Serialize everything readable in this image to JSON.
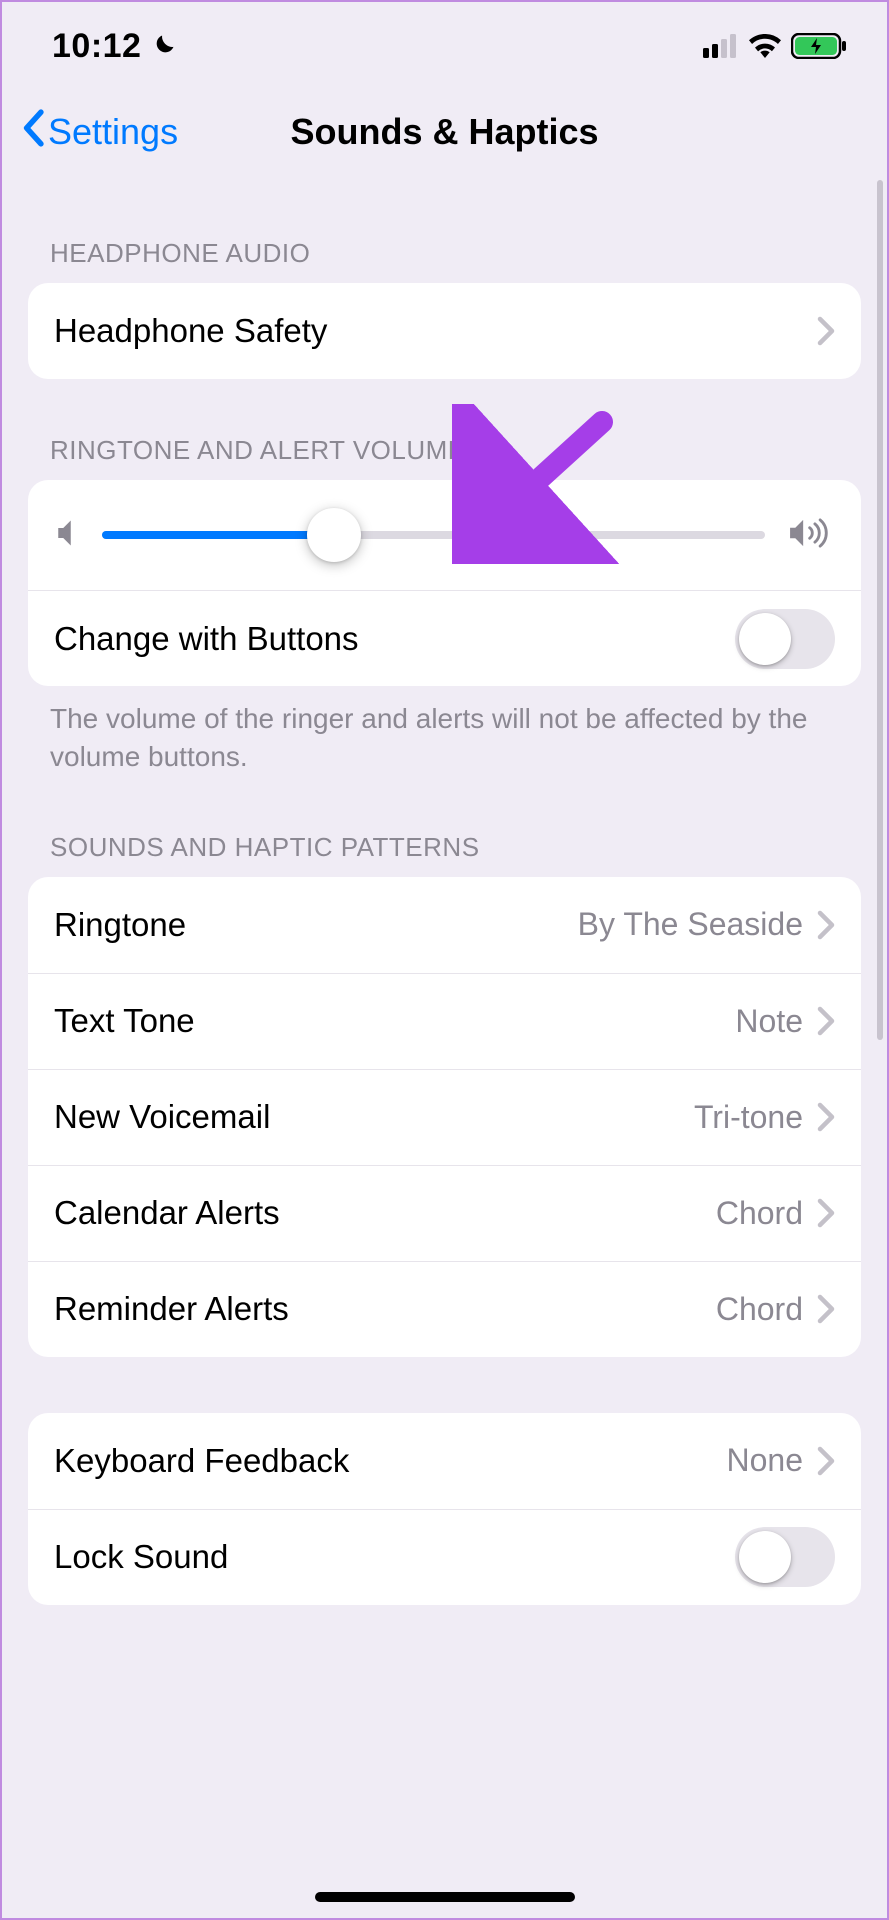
{
  "status": {
    "time": "10:12"
  },
  "nav": {
    "back": "Settings",
    "title": "Sounds & Haptics"
  },
  "headphone": {
    "header": "HEADPHONE AUDIO",
    "safety_label": "Headphone Safety"
  },
  "volume": {
    "header": "RINGTONE AND ALERT VOLUME",
    "slider_percent": 35,
    "change_label": "Change with Buttons",
    "change_on": false,
    "footer": "The volume of the ringer and alerts will not be affected by the volume buttons."
  },
  "patterns": {
    "header": "SOUNDS AND HAPTIC PATTERNS",
    "items": [
      {
        "label": "Ringtone",
        "value": "By The Seaside"
      },
      {
        "label": "Text Tone",
        "value": "Note"
      },
      {
        "label": "New Voicemail",
        "value": "Tri-tone"
      },
      {
        "label": "Calendar Alerts",
        "value": "Chord"
      },
      {
        "label": "Reminder Alerts",
        "value": "Chord"
      }
    ]
  },
  "system": {
    "keyboard_label": "Keyboard Feedback",
    "keyboard_value": "None",
    "lock_label": "Lock Sound",
    "lock_on": false
  },
  "annotation": {
    "arrow_color": "#a53ee8"
  }
}
